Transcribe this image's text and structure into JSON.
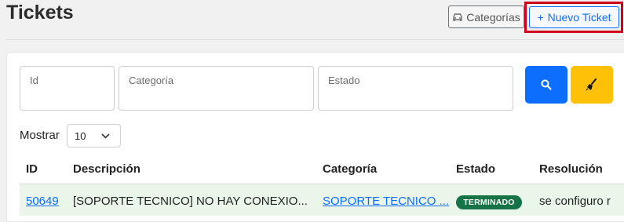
{
  "header": {
    "title": "Tickets",
    "categorias_label": "Categorías",
    "nuevo_icon": "+",
    "nuevo_label": "Nuevo Ticket"
  },
  "filters": {
    "id_placeholder": "Id",
    "categoria_placeholder": "Categoría",
    "estado_placeholder": "Estado",
    "search_icon": "search-icon",
    "clear_icon": "broom-icon"
  },
  "pagination": {
    "mostrar_label": "Mostrar",
    "page_size": "10"
  },
  "table": {
    "columns": [
      "ID",
      "Descripción",
      "Categoría",
      "Estado",
      "Resolución"
    ],
    "rows": [
      {
        "id": "50649",
        "descripcion": "[SOPORTE TECNICO] NO HAY CONEXIO...",
        "categoria": "SOPORTE TECNICO ...",
        "estado": "TERMINADO",
        "resolucion": "se configuro r"
      }
    ]
  },
  "colors": {
    "primary": "#0d6efd",
    "warning": "#ffc107",
    "success": "#157347",
    "highlight": "#d0021b"
  }
}
